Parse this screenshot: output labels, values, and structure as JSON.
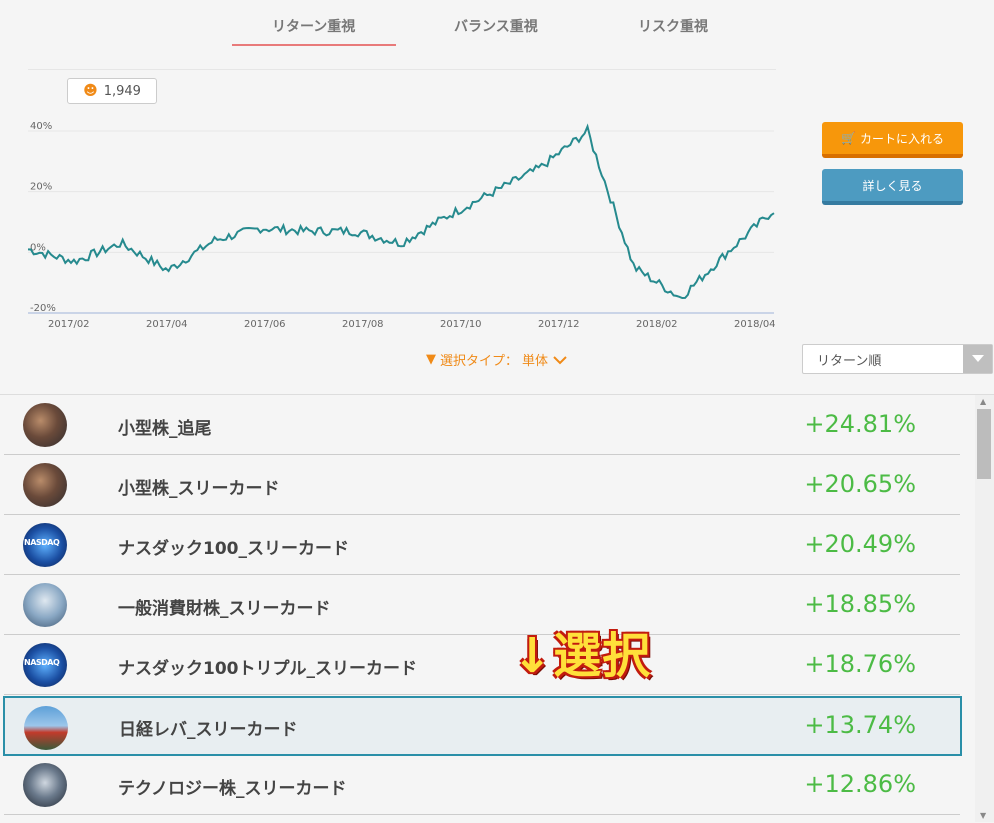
{
  "tabs": [
    {
      "label": "リターン重視",
      "active": true
    },
    {
      "label": "バランス重視",
      "active": false
    },
    {
      "label": "リスク重視",
      "active": false
    }
  ],
  "count_badge": {
    "icon": "users-icon",
    "value": "1,949"
  },
  "buttons": {
    "cart": "カートに入れる",
    "detail": "詳しく見る"
  },
  "filter": {
    "label": "選択タイプ：",
    "value": "単体"
  },
  "sort": {
    "selected": "リターン順"
  },
  "colors": {
    "line": "#268a8e",
    "positive": "#4cbb45",
    "accent": "#f08a17",
    "selected_border": "#2a8fa8"
  },
  "chart_data": {
    "type": "line",
    "ylim": [
      -20,
      40
    ],
    "yticks": [
      "40%",
      "20%",
      "0%",
      "-20%"
    ],
    "xticks": [
      "2017/02",
      "2017/04",
      "2017/06",
      "2017/08",
      "2017/10",
      "2017/12",
      "2018/02",
      "2018/04"
    ],
    "grid": true,
    "series": [
      {
        "x": [
          "2017/01",
          "2017/02",
          "2017/03",
          "2017/04",
          "2017/05",
          "2017/06",
          "2017/07",
          "2017/08",
          "2017/09",
          "2017/10",
          "2017/11",
          "2017/12",
          "2018/01",
          "2018/02",
          "2018/03",
          "2018/04",
          "2018/05"
        ],
        "values": [
          1,
          -3,
          3,
          -6,
          4,
          8,
          7,
          7,
          3,
          12,
          20,
          28,
          40,
          -5,
          -15,
          0,
          14
        ]
      }
    ]
  },
  "list": [
    {
      "name": "小型株_追尾",
      "return": "+24.81%",
      "icon": "small-cap-icon"
    },
    {
      "name": "小型株_スリーカード",
      "return": "+20.65%",
      "icon": "small-cap-icon"
    },
    {
      "name": "ナスダック100_スリーカード",
      "return": "+20.49%",
      "icon": "nasdaq-icon"
    },
    {
      "name": "一般消費財株_スリーカード",
      "return": "+18.85%",
      "icon": "consumer-icon"
    },
    {
      "name": "ナスダック100トリプル_スリーカード",
      "return": "+18.76%",
      "icon": "nasdaq-icon"
    },
    {
      "name": "日経レバ_スリーカード",
      "return": "+13.74%",
      "icon": "nikkei-icon",
      "selected": true
    },
    {
      "name": "テクノロジー株_スリーカード",
      "return": "+12.86%",
      "icon": "technology-icon"
    }
  ],
  "annotation": "↓選択"
}
